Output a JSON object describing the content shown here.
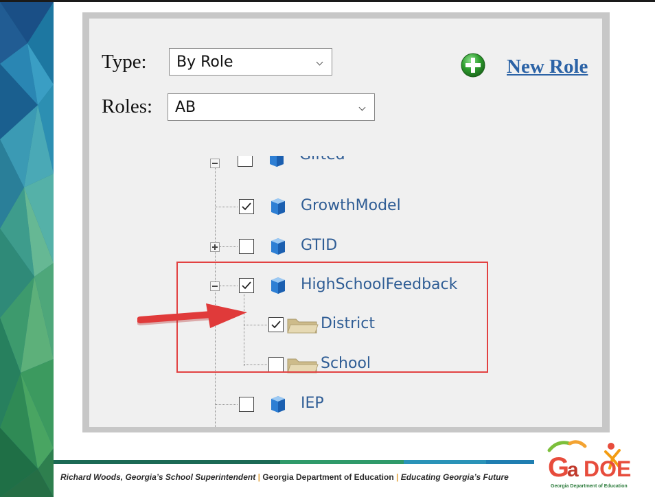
{
  "filters": {
    "type_label": "Type:",
    "type_value": "By Role",
    "roles_label": "Roles:",
    "roles_value": "AB"
  },
  "actions": {
    "new_role_label": "New Role"
  },
  "tree": {
    "partial_label": "Gifted",
    "nodes": [
      {
        "label": "GrowthModel",
        "checked": true
      },
      {
        "label": "GTID",
        "checked": false
      },
      {
        "label": "HighSchoolFeedback",
        "checked": true
      },
      {
        "label": "District",
        "checked": true
      },
      {
        "label": "School",
        "checked": false
      },
      {
        "label": "IEP",
        "checked": false
      }
    ]
  },
  "footer": {
    "superintendent": "Richard Woods, Georgia’s School Superintendent",
    "separator": "|",
    "department": "Georgia Department of Education",
    "tagline": "Educating Georgia’s Future"
  },
  "logo": {
    "alt_text": "GaDOE",
    "subtitle": "Georgia Department of Education"
  },
  "colors": {
    "link_blue": "#2c63a6",
    "node_blue": "#2f5d95",
    "highlight_red": "#e24141",
    "plus_green": "#2e9e2e",
    "folder_tan": "#d9c99c"
  },
  "icons": [
    "plus-circle-icon",
    "cube-icon",
    "folder-icon",
    "checkmark-icon",
    "chevron-down-icon",
    "arrow-icon"
  ]
}
